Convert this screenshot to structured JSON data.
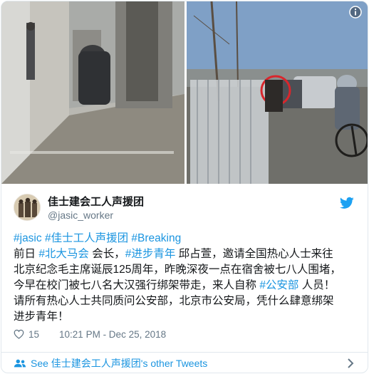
{
  "author": {
    "display_name": "佳士建会工人声援团",
    "handle": "@jasic_worker"
  },
  "tweet": {
    "hashtags_line": {
      "h1": "#jasic",
      "h2": "#佳士工人声援团",
      "h3": "#Breaking"
    },
    "line1": {
      "a": "前日 ",
      "tag1": "#北大马会",
      "b": " 会长，",
      "tag2": "#进步青年",
      "c": " 邱占萱，邀请全国热心人士来往"
    },
    "line2": "北京纪念毛主席诞辰125周年，昨晚深夜一点在宿舍被七八人围堵，",
    "line3": {
      "a": "今早在校门被七八名大汉强行绑架带走，来人自称 ",
      "tag": "#公安部",
      "b": " 人员！"
    },
    "line4": "请所有热心人士共同质问公安部，北京市公安局，凭什么肆意绑架",
    "line5": "进步青年！"
  },
  "meta": {
    "likes": "15",
    "timestamp": "10:21 PM - Dec 25, 2018"
  },
  "footer": {
    "see_other": "See 佳士建会工人声援团's other Tweets"
  },
  "icons": {
    "bird": "twitter-bird-icon",
    "heart": "heart-icon",
    "info": "info-icon",
    "people": "people-icon",
    "chevron": "chevron-right-icon"
  },
  "colors": {
    "link": "#1b95e0",
    "muted": "#657786",
    "text": "#14171a",
    "border": "#e1e8ed"
  }
}
